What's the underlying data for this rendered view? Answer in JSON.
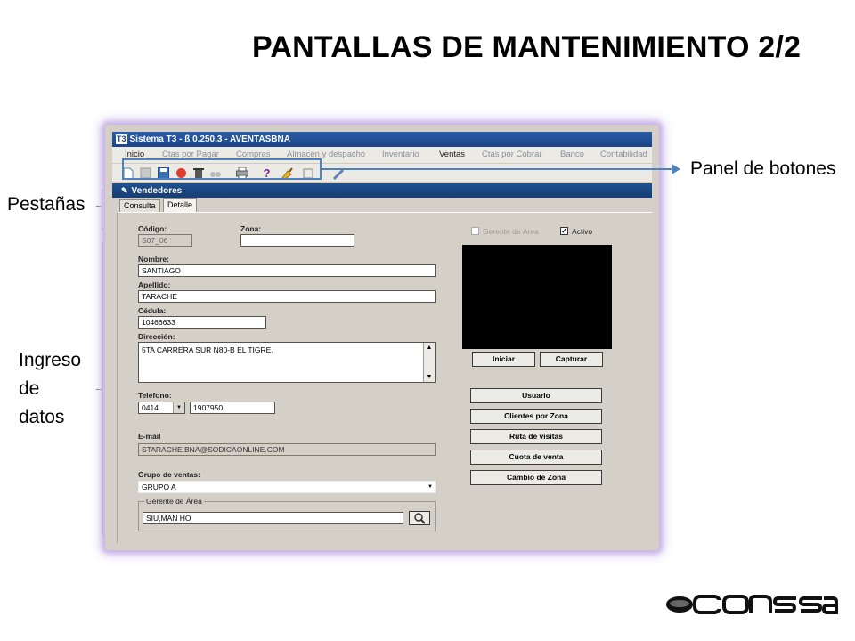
{
  "slide": {
    "title": "PANTALLAS DE MANTENIMIENTO 2/2"
  },
  "callouts": {
    "buttons_panel": "Panel de botones",
    "tabs": "Pestañas",
    "data_entry_1": "Ingreso",
    "data_entry_2": "de",
    "data_entry_3": "datos"
  },
  "app": {
    "title": "Sistema T3 - ß 0.250.3 - AVENTASBNA",
    "icon_text": "T3",
    "menu": [
      "Inicio",
      "Ctas por Pagar",
      "Compras",
      "Almacén y despacho",
      "Inventario",
      "Ventas",
      "Ctas por Cobrar",
      "Banco",
      "Contabilidad"
    ],
    "window_title": "Vendedores",
    "tabs": [
      "Consulta",
      "Detalle"
    ]
  },
  "form": {
    "codigo_label": "Código:",
    "codigo_value": "S07_06",
    "zona_label": "Zona:",
    "zona_value": "",
    "nombre_label": "Nombre:",
    "nombre_value": "SANTIAGO",
    "apellido_label": "Apellido:",
    "apellido_value": "TARACHE",
    "cedula_label": "Cédula:",
    "cedula_value": "10466633",
    "direccion_label": "Dirección:",
    "direccion_value": "5TA CARRERA SUR N80-B EL TIGRE.",
    "telefono_label": "Teléfono:",
    "telefono_code": "0414",
    "telefono_number": "1907950",
    "email_label": "E-mail",
    "email_value": "STARACHE.BNA@SODICAONLINE.COM",
    "grupo_label": "Grupo de ventas:",
    "grupo_value": "GRUPO A",
    "gerente_group_label": "Gerente de Área",
    "gerente_value": "SIU,MAN HO",
    "gerente_check_label": "Gerente de Área",
    "activo_label": "Activo"
  },
  "camera_buttons": [
    "Iniciar",
    "Capturar"
  ],
  "side_buttons": [
    "Usuario",
    "Clientes por Zona",
    "Ruta de visitas",
    "Cuota de venta",
    "Cambio de Zona"
  ],
  "colors": {
    "highlight": "#4f81bd",
    "glow": "#c8b4e6"
  }
}
